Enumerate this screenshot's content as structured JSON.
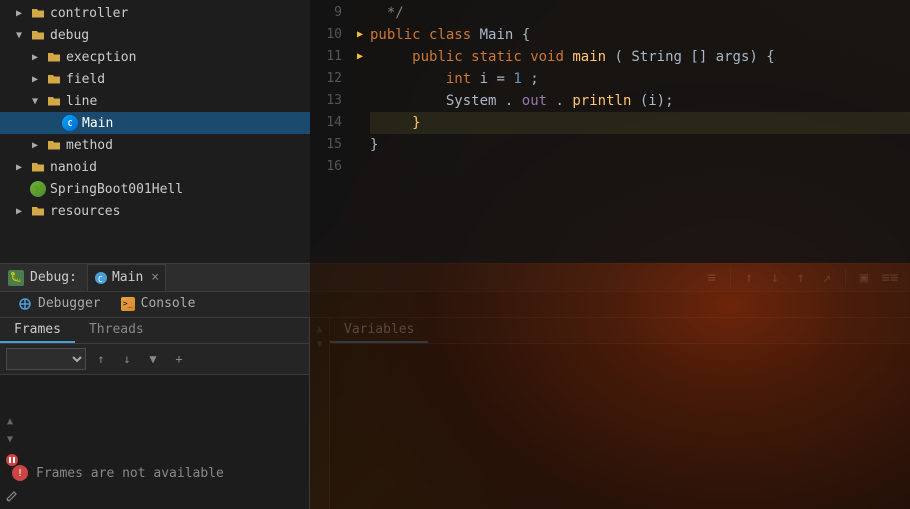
{
  "sidebar": {
    "items": [
      {
        "label": "controller",
        "type": "folder",
        "indent": 1,
        "open": false
      },
      {
        "label": "debug",
        "type": "folder",
        "indent": 1,
        "open": true
      },
      {
        "label": "execption",
        "type": "folder",
        "indent": 2,
        "open": false
      },
      {
        "label": "field",
        "type": "folder",
        "indent": 2,
        "open": false
      },
      {
        "label": "line",
        "type": "folder",
        "indent": 2,
        "open": true
      },
      {
        "label": "Main",
        "type": "java",
        "indent": 3,
        "selected": true
      },
      {
        "label": "method",
        "type": "folder",
        "indent": 2,
        "open": false
      },
      {
        "label": "nanoid",
        "type": "folder",
        "indent": 1,
        "open": false
      },
      {
        "label": "SpringBoot001Hell",
        "type": "spring",
        "indent": 1
      },
      {
        "label": "resources",
        "type": "folder",
        "indent": 1,
        "open": false
      }
    ]
  },
  "editor": {
    "lines": [
      {
        "num": 9,
        "content": " */",
        "type": "comment",
        "marker": ""
      },
      {
        "num": 10,
        "content": "public class Main {",
        "type": "code",
        "marker": "▶"
      },
      {
        "num": 11,
        "content": "    public static void main(String[] args) {",
        "type": "code",
        "marker": "▶"
      },
      {
        "num": 12,
        "content": "        int i =1;",
        "type": "code",
        "marker": ""
      },
      {
        "num": 13,
        "content": "        System.out.println(i);",
        "type": "code",
        "marker": ""
      },
      {
        "num": 14,
        "content": "    }",
        "type": "code",
        "marker": "",
        "highlight": true
      },
      {
        "num": 15,
        "content": "}",
        "type": "code",
        "marker": ""
      },
      {
        "num": 16,
        "content": "",
        "type": "empty",
        "marker": ""
      }
    ]
  },
  "debug": {
    "title": "Debug:",
    "tab_label": "Main",
    "close_symbol": "×",
    "bug_icon": "🐛",
    "tabs": [
      {
        "label": "Debugger",
        "active": false
      },
      {
        "label": "Console",
        "active": false
      }
    ],
    "toolbar_buttons": [
      "≡",
      "↑",
      "↓",
      "↑",
      "↗",
      "▣",
      "≡≡"
    ],
    "panels": {
      "frames": {
        "tabs": [
          "Frames",
          "Threads"
        ],
        "active_tab": "Frames"
      },
      "variables": {
        "tab": "Variables"
      }
    },
    "frames_empty_text": "Frames are not available",
    "frames_select_placeholder": ""
  },
  "colors": {
    "accent_blue": "#4a9ed6",
    "selected_bg": "#1a4a6e",
    "keyword": "#cc7832",
    "function": "#ffc66d",
    "comment": "#808080",
    "number": "#6897bb",
    "string": "#6a8759",
    "plain": "#a9b7c6"
  }
}
